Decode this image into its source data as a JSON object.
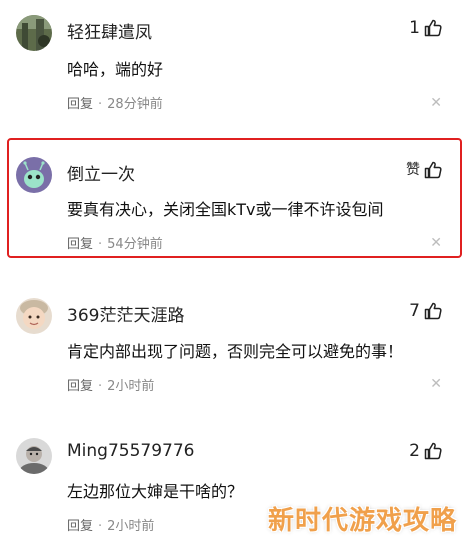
{
  "comments": [
    {
      "username": "轻狂肆遣凤",
      "likes": "1",
      "text": "哈哈，端的好",
      "reply_label": "回复",
      "time": "28分钟前",
      "close_glyph": "✕",
      "avatar": "scenery-avatar"
    },
    {
      "username": "倒立一次",
      "likes": "赞",
      "text": "要真有决心，关闭全国kTv或一律不许设包间",
      "reply_label": "回复",
      "time": "54分钟前",
      "close_glyph": "✕",
      "avatar": "alien-avatar"
    },
    {
      "username": "369茫茫天涯路",
      "likes": "7",
      "text": "肯定内部出现了问题，否则完全可以避免的事！",
      "reply_label": "回复",
      "time": "2小时前",
      "close_glyph": "✕",
      "avatar": "baby-avatar"
    },
    {
      "username": "Ming75579776",
      "likes": "2",
      "text": "左边那位大婶是干啥的？",
      "reply_label": "回复",
      "time": "2小时前",
      "close_glyph": "✕",
      "avatar": "man-avatar"
    }
  ],
  "meta_separator": "·",
  "watermark": "新时代游戏攻略",
  "colors": {
    "highlight_border": "#e02020",
    "meta_text": "#888888",
    "watermark": "#f0a04b"
  }
}
